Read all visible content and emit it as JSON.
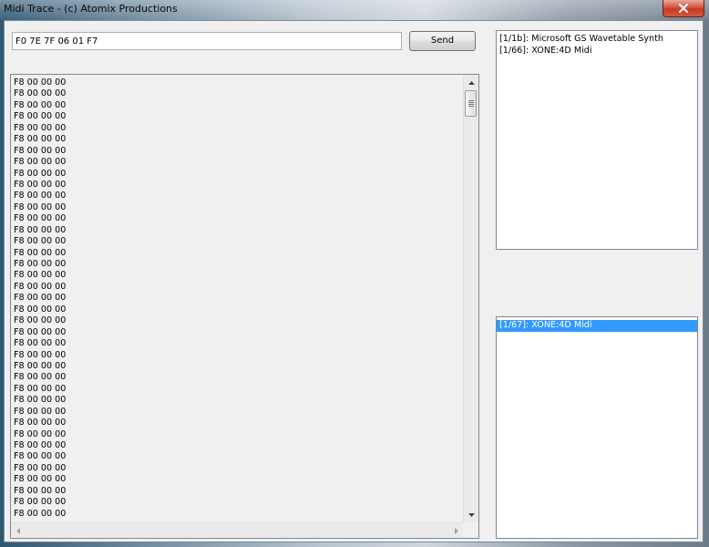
{
  "window": {
    "title": "Midi Trace - (c) Atomix Productions"
  },
  "sysex": {
    "value": "F0 7E 7F 06 01 F7",
    "send_label": "Send"
  },
  "trace": {
    "lines": [
      "F8 00 00 00",
      "F8 00 00 00",
      "F8 00 00 00",
      "F8 00 00 00",
      "F8 00 00 00",
      "F8 00 00 00",
      "F8 00 00 00",
      "F8 00 00 00",
      "F8 00 00 00",
      "F8 00 00 00",
      "F8 00 00 00",
      "F8 00 00 00",
      "F8 00 00 00",
      "F8 00 00 00",
      "F8 00 00 00",
      "F8 00 00 00",
      "F8 00 00 00",
      "F8 00 00 00",
      "F8 00 00 00",
      "F8 00 00 00",
      "F8 00 00 00",
      "F8 00 00 00",
      "F8 00 00 00",
      "F8 00 00 00",
      "F8 00 00 00",
      "F8 00 00 00",
      "F8 00 00 00",
      "F8 00 00 00",
      "F8 00 00 00",
      "F8 00 00 00",
      "F8 00 00 00",
      "F8 00 00 00",
      "F8 00 00 00",
      "F8 00 00 00",
      "F8 00 00 00",
      "F8 00 00 00",
      "F8 00 00 00",
      "F8 00 00 00",
      "F8 00 00 00"
    ]
  },
  "output_devices": {
    "items": [
      {
        "label": "[1/1b]: Microsoft GS Wavetable Synth",
        "selected": false
      },
      {
        "label": "[1/66]: XONE:4D Midi",
        "selected": false
      }
    ]
  },
  "input_devices": {
    "items": [
      {
        "label": "[1/67]: XONE:4D Midi",
        "selected": true
      }
    ]
  },
  "colors": {
    "selection": "#3399ff",
    "close_button": "#c23a22"
  },
  "icons": [
    "close-icon",
    "scroll-up-arrow-icon",
    "scroll-down-arrow-icon",
    "scroll-left-arrow-icon",
    "scroll-right-arrow-icon"
  ]
}
